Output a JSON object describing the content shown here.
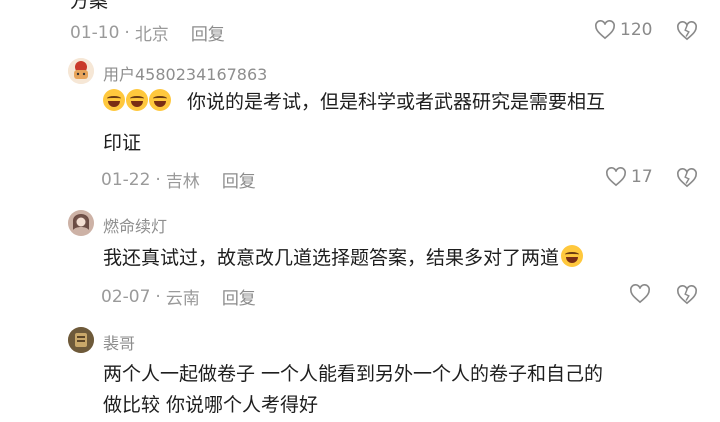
{
  "top_fragment": {
    "text": "方案"
  },
  "comments": [
    {
      "date": "01-10",
      "location": "北京",
      "reply_label": "回复",
      "likes": "120"
    },
    {
      "username": "用户4580234167863",
      "text_line1": "你说的是考试，但是科学或者武器研究是需要相互",
      "text_line2": "印证",
      "emoji_count": 3,
      "date": "01-22",
      "location": "吉林",
      "reply_label": "回复",
      "likes": "17"
    },
    {
      "username": "燃命续灯",
      "text_line1": "我还真试过，故意改几道选择题答案，结果多对了两道",
      "date": "02-07",
      "location": "云南",
      "reply_label": "回复",
      "likes": ""
    },
    {
      "username": "裴哥",
      "text_line1": "两个人一起做卷子 一个人能看到另外一个人的卷子和自己的",
      "text_line2": "做比较 你说哪个人考得好"
    }
  ],
  "icons": {
    "like": "heart-outline-icon",
    "dislike": "broken-heart-icon",
    "emoji_laugh": "laughing-tears-emoji",
    "emoji_grin": "grinning-emoji"
  },
  "colors": {
    "meta_text": "#9a9a9a",
    "body_text": "#1e1e1e",
    "username": "#8e8e8e"
  }
}
